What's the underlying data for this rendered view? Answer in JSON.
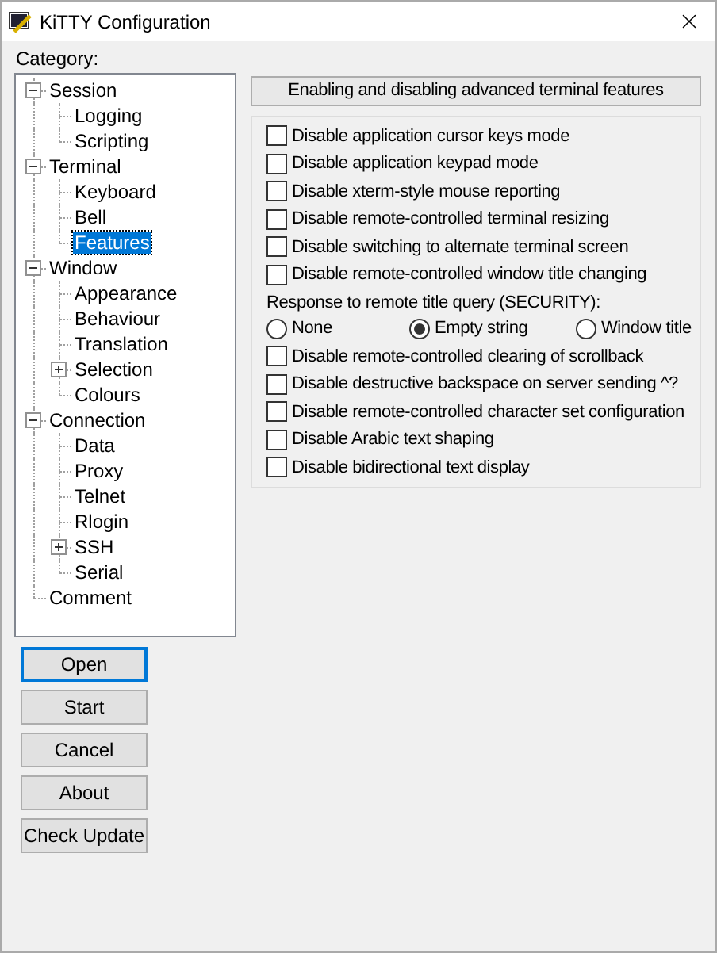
{
  "window": {
    "title": "KiTTY Configuration"
  },
  "category_label": "Category:",
  "tree": [
    {
      "label": "Session",
      "expanded": true,
      "selected": false,
      "children": [
        {
          "label": "Logging",
          "selected": false
        },
        {
          "label": "Scripting",
          "selected": false
        }
      ]
    },
    {
      "label": "Terminal",
      "expanded": true,
      "selected": false,
      "children": [
        {
          "label": "Keyboard",
          "selected": false
        },
        {
          "label": "Bell",
          "selected": false
        },
        {
          "label": "Features",
          "selected": true
        }
      ]
    },
    {
      "label": "Window",
      "expanded": true,
      "selected": false,
      "children": [
        {
          "label": "Appearance",
          "selected": false
        },
        {
          "label": "Behaviour",
          "selected": false
        },
        {
          "label": "Translation",
          "selected": false
        },
        {
          "label": "Selection",
          "expanded": false,
          "selected": false
        },
        {
          "label": "Colours",
          "selected": false
        }
      ]
    },
    {
      "label": "Connection",
      "expanded": true,
      "selected": false,
      "children": [
        {
          "label": "Data",
          "selected": false
        },
        {
          "label": "Proxy",
          "selected": false
        },
        {
          "label": "Telnet",
          "selected": false
        },
        {
          "label": "Rlogin",
          "selected": false
        },
        {
          "label": "SSH",
          "expanded": false,
          "selected": false
        },
        {
          "label": "Serial",
          "selected": false
        }
      ]
    },
    {
      "label": "Comment",
      "selected": false
    }
  ],
  "buttons": [
    {
      "label": "Open",
      "default": true
    },
    {
      "label": "Start",
      "default": false
    },
    {
      "label": "Cancel",
      "default": false
    },
    {
      "label": "About",
      "default": false
    },
    {
      "label": "Check Update",
      "default": false
    }
  ],
  "panel_header": "Enabling and disabling advanced terminal features",
  "options": [
    {
      "kind": "checkbox",
      "label": "Disable application cursor keys mode",
      "checked": false
    },
    {
      "kind": "checkbox",
      "label": "Disable application keypad mode",
      "checked": false
    },
    {
      "kind": "checkbox",
      "label": "Disable xterm-style mouse reporting",
      "checked": false
    },
    {
      "kind": "checkbox",
      "label": "Disable remote-controlled terminal resizing",
      "checked": false
    },
    {
      "kind": "checkbox",
      "label": "Disable switching to alternate terminal screen",
      "checked": false
    },
    {
      "kind": "checkbox",
      "label": "Disable remote-controlled window title changing",
      "checked": false
    },
    {
      "kind": "label",
      "label": "Response to remote title query (SECURITY):"
    },
    {
      "kind": "radio_group",
      "choices": [
        {
          "label": "None",
          "selected": false
        },
        {
          "label": "Empty string",
          "selected": true
        },
        {
          "label": "Window title",
          "selected": false
        }
      ]
    },
    {
      "kind": "checkbox",
      "label": "Disable remote-controlled clearing of scrollback",
      "checked": false
    },
    {
      "kind": "checkbox",
      "label": "Disable destructive backspace on server sending ^?",
      "checked": false
    },
    {
      "kind": "checkbox",
      "label": "Disable remote-controlled character set configuration",
      "checked": false
    },
    {
      "kind": "checkbox",
      "label": "Disable Arabic text shaping",
      "checked": false
    },
    {
      "kind": "checkbox",
      "label": "Disable bidirectional text display",
      "checked": false
    }
  ]
}
